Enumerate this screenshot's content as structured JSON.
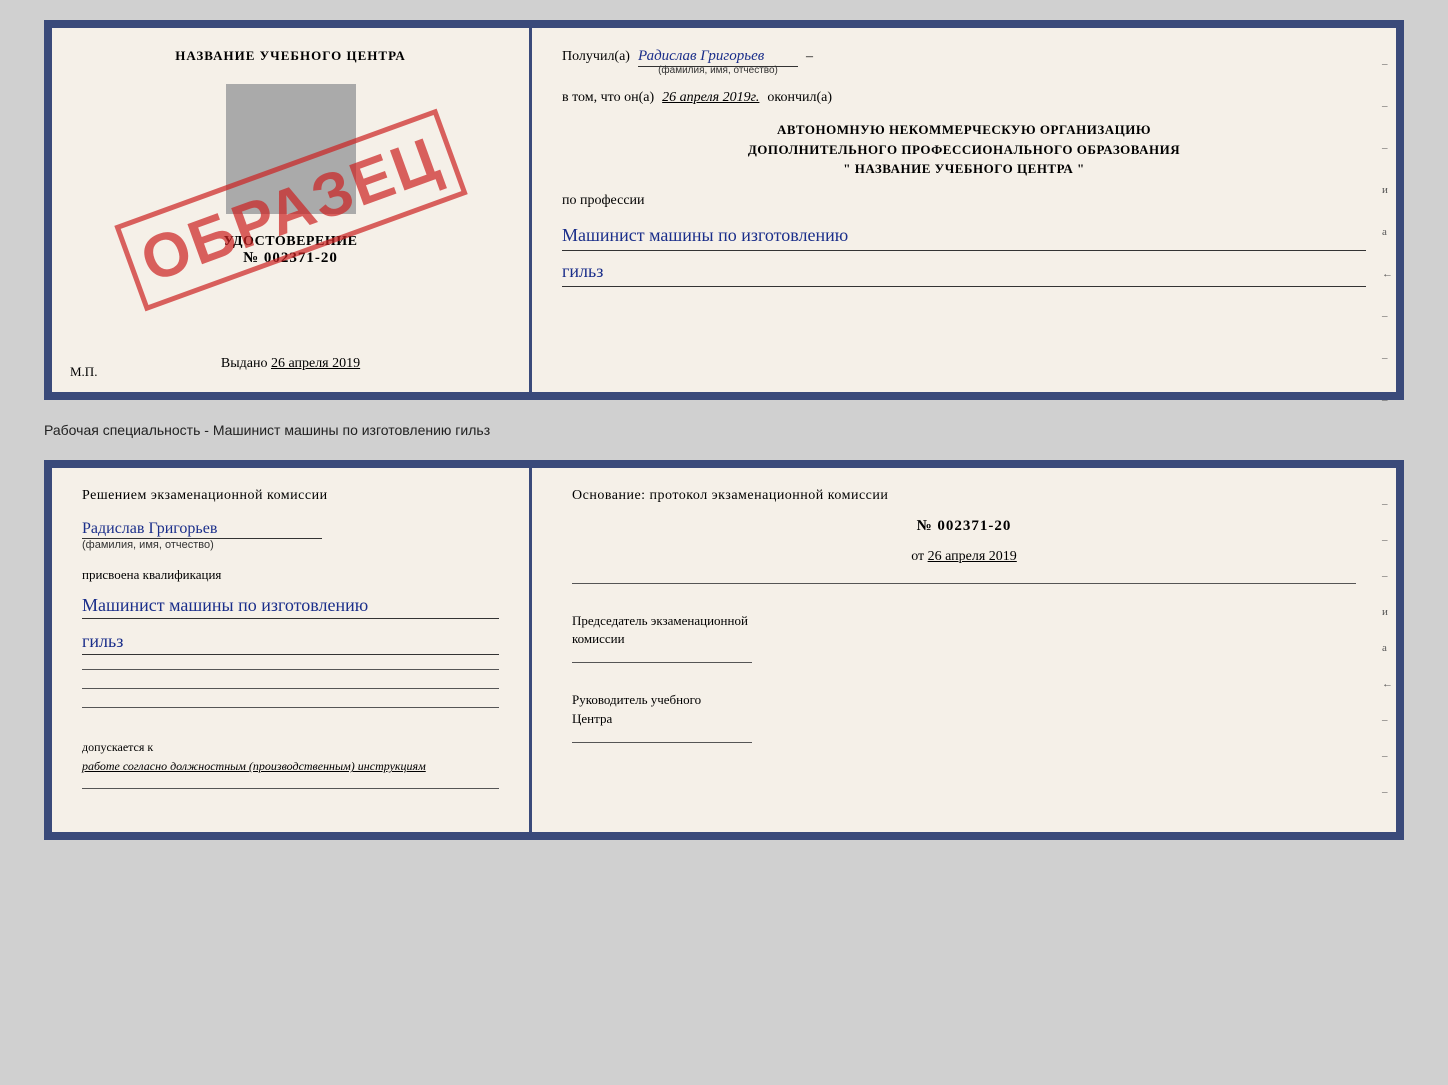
{
  "top_cert": {
    "left": {
      "title": "НАЗВАНИЕ УЧЕБНОГО ЦЕНТРА",
      "doc_title": "УДОСТОВЕРЕНИЕ",
      "doc_number": "№ 002371-20",
      "issued_label": "Выдано",
      "issued_date": "26 апреля 2019",
      "mp_label": "М.П.",
      "stamp_text": "ОБРАЗЕЦ"
    },
    "right": {
      "received_label": "Получил(а)",
      "recipient_name": "Радислав Григорьев",
      "recipient_sub": "(фамилия, имя, отчество)",
      "completed_prefix": "в том, что он(а)",
      "completed_date": "26 апреля 2019г.",
      "completed_suffix": "окончил(а)",
      "org_line1": "АВТОНОМНУЮ НЕКОММЕРЧЕСКУЮ ОРГАНИЗАЦИЮ",
      "org_line2": "ДОПОЛНИТЕЛЬНОГО ПРОФЕССИОНАЛЬНОГО ОБРАЗОВАНИЯ",
      "org_line3": "\"  НАЗВАНИЕ УЧЕБНОГО ЦЕНТРА  \"",
      "profession_prefix": "по профессии",
      "profession_text": "Машинист машины по изготовлению",
      "profession_text2": "гильз",
      "edge_marks": [
        "-",
        "-",
        "-",
        "и",
        "а",
        "←",
        "-",
        "-",
        "-"
      ]
    }
  },
  "separator": {
    "text": "Рабочая специальность - Машинист машины по изготовлению гильз"
  },
  "bottom_cert": {
    "left": {
      "decision_text": "Решением  экзаменационной  комиссии",
      "person_name": "Радислав Григорьев",
      "person_sub": "(фамилия, имя, отчество)",
      "qualification_prefix": "присвоена квалификация",
      "qualification_text": "Машинист машины по изготовлению",
      "qualification_text2": "гильз",
      "allow_prefix": "допускается к",
      "allow_text": "работе согласно должностным (производственным) инструкциям"
    },
    "right": {
      "basis_label": "Основание: протокол экзаменационной  комиссии",
      "protocol_number": "№  002371-20",
      "date_prefix": "от",
      "protocol_date": "26 апреля 2019",
      "chairman_label1": "Председатель экзаменационной",
      "chairman_label2": "комиссии",
      "director_label1": "Руководитель учебного",
      "director_label2": "Центра",
      "edge_marks": [
        "-",
        "-",
        "-",
        "и",
        "а",
        "←",
        "-",
        "-",
        "-"
      ]
    }
  }
}
